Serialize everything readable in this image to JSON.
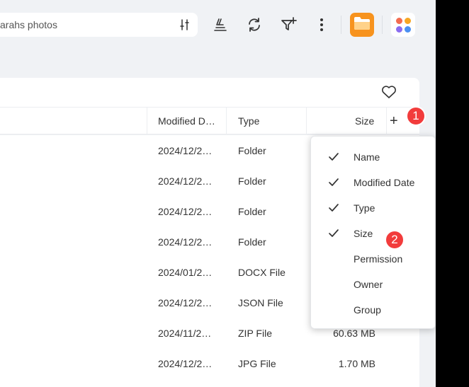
{
  "toolbar": {
    "search_placeholder": "arahs photos"
  },
  "table": {
    "columns": [
      "Modified D…",
      "Type",
      "Size"
    ],
    "rows": [
      {
        "modified": "2024/12/2…",
        "type": "Folder",
        "size": ""
      },
      {
        "modified": "2024/12/2…",
        "type": "Folder",
        "size": ""
      },
      {
        "modified": "2024/12/2…",
        "type": "Folder",
        "size": ""
      },
      {
        "modified": "2024/12/2…",
        "type": "Folder",
        "size": ""
      },
      {
        "modified": "2024/01/2…",
        "type": "DOCX File",
        "size": ""
      },
      {
        "modified": "2024/12/2…",
        "type": "JSON File",
        "size": ""
      },
      {
        "modified": "2024/11/2…",
        "type": "ZIP File",
        "size": "60.63 MB"
      },
      {
        "modified": "2024/12/2…",
        "type": "JPG File",
        "size": "1.70 MB"
      }
    ],
    "add_column_label": "+"
  },
  "column_menu": {
    "items": [
      {
        "label": "Name",
        "checked": true
      },
      {
        "label": "Modified Date",
        "checked": true
      },
      {
        "label": "Type",
        "checked": true
      },
      {
        "label": "Size",
        "checked": true
      },
      {
        "label": "Permission",
        "checked": false
      },
      {
        "label": "Owner",
        "checked": false
      },
      {
        "label": "Group",
        "checked": false
      }
    ]
  },
  "badges": {
    "step1": "1",
    "step2": "2"
  },
  "colors": {
    "accent_orange": "#f7931e",
    "badge_red": "#f23c3c",
    "background": "#f0f2f5"
  },
  "icons": [
    "filter-sliders-icon",
    "sort-stack-icon",
    "refresh-icon",
    "filter-add-icon",
    "more-vertical-icon",
    "folder-icon",
    "apps-icon",
    "heart-icon",
    "check-icon"
  ]
}
